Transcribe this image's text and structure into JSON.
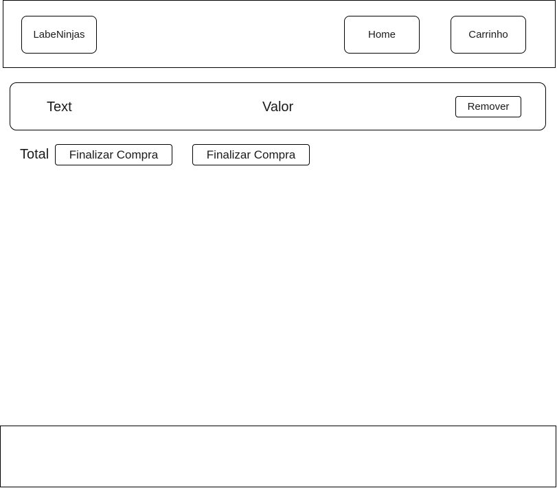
{
  "header": {
    "logo_label": "LabeNinjas",
    "nav": {
      "home_label": "Home",
      "cart_label": "Carrinho"
    }
  },
  "cart": {
    "items": [
      {
        "text": "Text",
        "value": "Valor",
        "remove_label": "Remover"
      }
    ],
    "total_label": "Total",
    "finish_buttons": [
      "Finalizar Compra",
      "Finalizar Compra"
    ]
  },
  "footer": {}
}
